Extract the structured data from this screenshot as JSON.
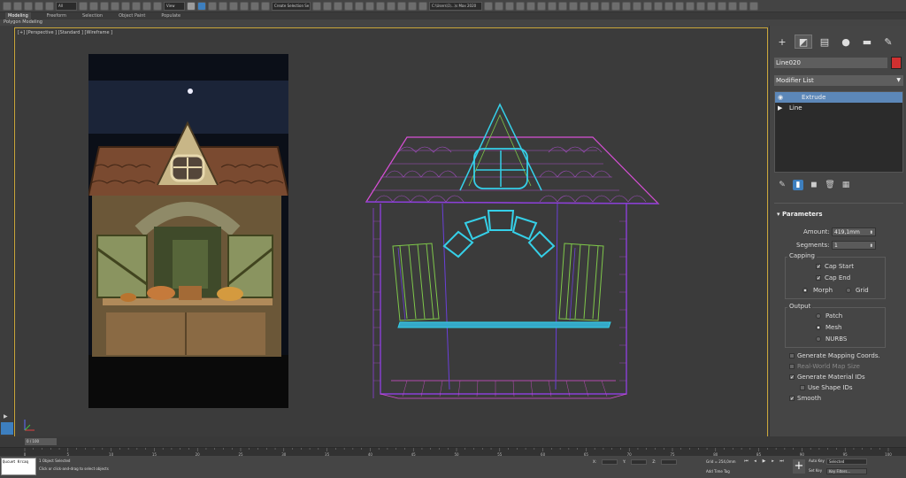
{
  "toolbar": {
    "selection_filter": "All",
    "view_dropdown": "View",
    "selection_set": "Create Selection Se",
    "workspace": "C:\\Users\\1\\...\\s Max 2020",
    "snap_label": "3"
  },
  "ribbon": {
    "tabs": [
      "Modeling",
      "Freeform",
      "Selection",
      "Object Paint",
      "Populate"
    ],
    "sub_label": "Polygon Modeling"
  },
  "viewport": {
    "label": "[+] [Perspective ] [Standard ] [Wireframe ]"
  },
  "command_panel": {
    "tabs": [
      "create-icon",
      "modify-icon",
      "hierarchy-icon",
      "motion-icon",
      "display-icon",
      "utilities-icon"
    ],
    "object_name": "Line020",
    "object_color": "#d03030",
    "modifier_list_label": "Modifier List",
    "stack": [
      {
        "label": "Extrude",
        "icon": "eye-icon",
        "selected": true
      },
      {
        "label": "Line",
        "icon": "expand-arrow-icon",
        "selected": false
      }
    ]
  },
  "parameters": {
    "title": "Parameters",
    "amount_label": "Amount:",
    "amount_value": "419,1mm",
    "segments_label": "Segments:",
    "segments_value": "1",
    "capping": {
      "title": "Capping",
      "cap_start": "Cap Start",
      "cap_end": "Cap End",
      "morph": "Morph",
      "grid": "Grid"
    },
    "output": {
      "title": "Output",
      "patch": "Patch",
      "mesh": "Mesh",
      "nurbs": "NURBS"
    },
    "gen_mapping": "Generate Mapping Coords.",
    "real_world": "Real-World Map Size",
    "gen_material": "Generate Material IDs",
    "use_shape_ids": "Use Shape IDs",
    "smooth": "Smooth"
  },
  "timeline": {
    "slider_label": "0 / 100",
    "ticks": [
      "0",
      "5",
      "10",
      "15",
      "20",
      "25",
      "30",
      "35",
      "40",
      "45",
      "50",
      "55",
      "60",
      "65",
      "70",
      "75",
      "80",
      "85",
      "90",
      "95",
      "100"
    ]
  },
  "status": {
    "maxscript": "Qucuet Krcaq",
    "line1": "1 Object Selected",
    "line2": "Click or click-and-drag to select objects",
    "x_label": "X:",
    "y_label": "Y:",
    "z_label": "Z:",
    "grid": "Grid = 254,0mm",
    "add_time_tag": "Add Time Tag",
    "auto_key": "Auto Key",
    "set_key": "Set Key",
    "selected": "Selected",
    "key_filters": "Key Filters..."
  },
  "colors": {
    "accent": "#3d7fbf",
    "viewport_border": "#c9a63a",
    "wire_cyan": "#35d0e8",
    "wire_purple": "#8a3fd8",
    "wire_pink": "#d84fd6",
    "wire_green": "#7fc84a"
  }
}
